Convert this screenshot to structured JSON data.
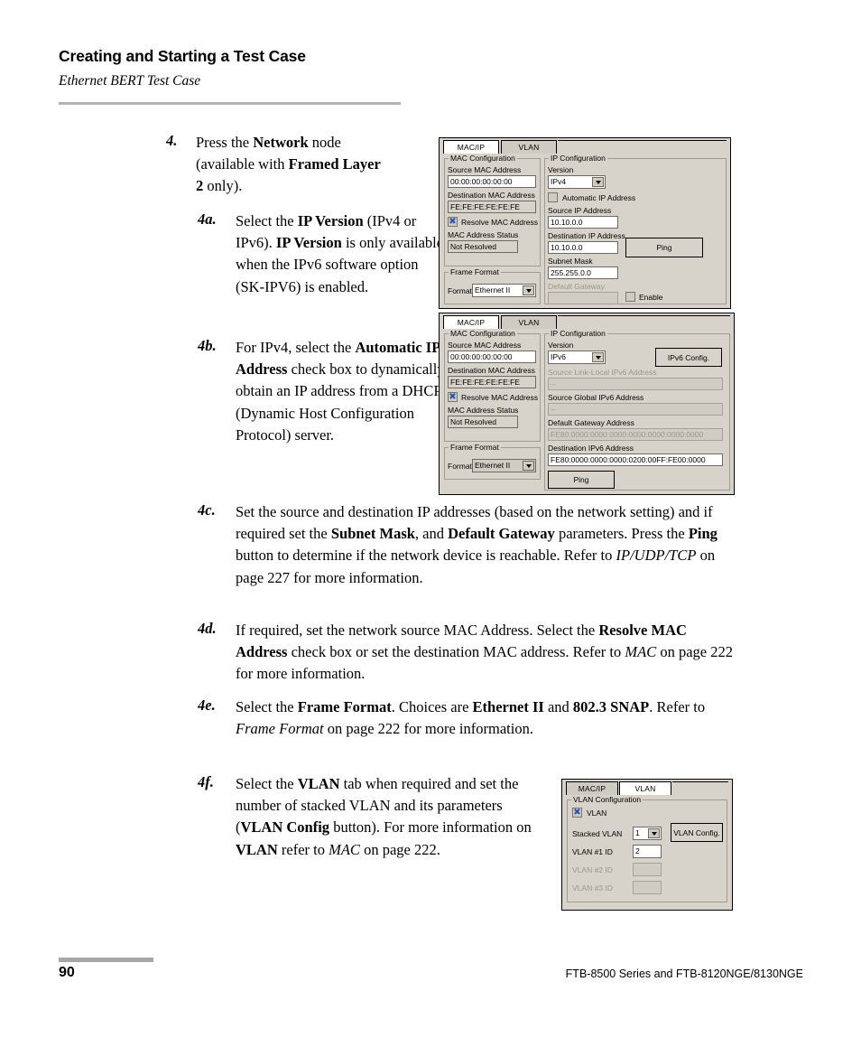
{
  "header": {
    "title": "Creating and Starting a Test Case",
    "subtitle": "Ethernet BERT Test Case"
  },
  "footer": {
    "page_number": "90",
    "product_line": "FTB-8500 Series and FTB-8120NGE/8130NGE"
  },
  "steps": [
    {
      "id": "4",
      "number": "4.",
      "text_runs": [
        {
          "t": "Press the ",
          "s": "normal"
        },
        {
          "t": "Network",
          "s": "bold"
        },
        {
          "t": " node (available with ",
          "s": "normal"
        },
        {
          "t": "Framed Layer 2",
          "s": "bold"
        },
        {
          "t": " only).",
          "s": "normal"
        }
      ]
    },
    {
      "id": "4a",
      "number": "4a.",
      "text_runs": [
        {
          "t": "Select the ",
          "s": "normal"
        },
        {
          "t": "IP Version",
          "s": "bold"
        },
        {
          "t": " (IPv4 or IPv6). ",
          "s": "normal"
        },
        {
          "t": "IP Version",
          "s": "bold"
        },
        {
          "t": " is only available when the IPv6 software option (SK-IPV6) is enabled.",
          "s": "normal"
        }
      ]
    },
    {
      "id": "4b",
      "number": "4b.",
      "text_runs": [
        {
          "t": "For IPv4, select the ",
          "s": "normal"
        },
        {
          "t": "Automatic IP Address",
          "s": "bold"
        },
        {
          "t": " check box to dynamically obtain an IP address from a DHCP (Dynamic Host Configuration Protocol) server.",
          "s": "normal"
        }
      ]
    },
    {
      "id": "4c",
      "number": "4c.",
      "text_runs": [
        {
          "t": "Set the source and destination IP addresses (based on the network setting) and if required set the ",
          "s": "normal"
        },
        {
          "t": "Subnet Mask",
          "s": "bold"
        },
        {
          "t": ", and ",
          "s": "normal"
        },
        {
          "t": "Default Gateway",
          "s": "bold"
        },
        {
          "t": " parameters. Press the ",
          "s": "normal"
        },
        {
          "t": "Ping",
          "s": "bold"
        },
        {
          "t": " button to determine if the network device is reachable. Refer to ",
          "s": "normal"
        },
        {
          "t": "IP/UDP/TCP",
          "s": "italic"
        },
        {
          "t": " on page 227 for more information.",
          "s": "normal"
        }
      ]
    },
    {
      "id": "4d",
      "number": "4d.",
      "text_runs": [
        {
          "t": "If required, set the network source MAC Address. Select the ",
          "s": "normal"
        },
        {
          "t": "Resolve MAC Address",
          "s": "bold"
        },
        {
          "t": " check box or set the destination MAC address. Refer to ",
          "s": "normal"
        },
        {
          "t": "MAC",
          "s": "italic"
        },
        {
          "t": " on page 222 for more information.",
          "s": "normal"
        }
      ]
    },
    {
      "id": "4e",
      "number": "4e.",
      "text_runs": [
        {
          "t": "Select the ",
          "s": "normal"
        },
        {
          "t": "Frame Format",
          "s": "bold"
        },
        {
          "t": ". Choices are ",
          "s": "normal"
        },
        {
          "t": "Ethernet II",
          "s": "bold"
        },
        {
          "t": " and ",
          "s": "normal"
        },
        {
          "t": "802.3 SNAP",
          "s": "bold"
        },
        {
          "t": ". Refer to ",
          "s": "normal"
        },
        {
          "t": "Frame Format",
          "s": "italic"
        },
        {
          "t": " on page 222 for more information.",
          "s": "normal"
        }
      ]
    },
    {
      "id": "4f",
      "number": "4f.",
      "text_runs": [
        {
          "t": "Select the ",
          "s": "normal"
        },
        {
          "t": "VLAN",
          "s": "bold"
        },
        {
          "t": " tab when required and set the number of stacked VLAN and its parameters (",
          "s": "normal"
        },
        {
          "t": "VLAN Config",
          "s": "bold"
        },
        {
          "t": " button). For more information on ",
          "s": "normal"
        },
        {
          "t": "VLAN",
          "s": "bold"
        },
        {
          "t": " refer to ",
          "s": "normal"
        },
        {
          "t": "MAC",
          "s": "italic"
        },
        {
          "t": " on page 222.",
          "s": "normal"
        }
      ]
    }
  ],
  "dialog_ipv4": {
    "tabs": [
      {
        "label": "MAC/IP",
        "active": true
      },
      {
        "label": "VLAN",
        "active": false
      }
    ],
    "mac_group_title": "MAC Configuration",
    "source_mac_label": "Source MAC Address",
    "source_mac_value": "00:00:00:00:00:00",
    "destination_mac_label": "Destination MAC Address",
    "destination_mac_value": "FE:FE:FE:FE:FE:FE",
    "resolve_mac_label": "Resolve MAC Address",
    "resolve_mac_checked": true,
    "mac_status_label": "MAC Address Status",
    "mac_status_value": "Not Resolved",
    "frame_format_group_title": "Frame Format",
    "format_label": "Format",
    "format_value": "Ethernet II",
    "ip_group_title": "IP Configuration",
    "version_label": "Version",
    "version_value": "IPv4",
    "automatic_ip_label": "Automatic IP Address",
    "automatic_ip_checked": false,
    "source_ip_label": "Source IP Address",
    "source_ip_value": "10.10.0.0",
    "destination_ip_label": "Destination IP Address",
    "destination_ip_value": "10.10.0.0",
    "subnet_mask_label": "Subnet Mask",
    "subnet_mask_value": "255.255.0.0",
    "default_gateway_label": "Default Gateway",
    "default_gateway_value": "",
    "enable_label": "Enable",
    "enable_checked": false,
    "ping_label": "Ping"
  },
  "dialog_ipv6": {
    "tabs": [
      {
        "label": "MAC/IP",
        "active": true
      },
      {
        "label": "VLAN",
        "active": false
      }
    ],
    "mac_group_title": "MAC Configuration",
    "source_mac_label": "Source MAC Address",
    "source_mac_value": "00:00:00:00:00:00",
    "destination_mac_label": "Destination MAC Address",
    "destination_mac_value": "FE:FE:FE:FE:FE:FE",
    "resolve_mac_label": "Resolve MAC Address",
    "resolve_mac_checked": true,
    "mac_status_label": "MAC Address Status",
    "mac_status_value": "Not Resolved",
    "frame_format_group_title": "Frame Format",
    "format_label": "Format",
    "format_value": "Ethernet II",
    "ip_group_title": "IP Configuration",
    "version_label": "Version",
    "version_value": "IPv6",
    "ipv6_config_label": "IPv6 Config.",
    "source_link_local_label": "Source Link-Local IPv6 Address",
    "source_link_local_value": "--",
    "source_global_label": "Source Global IPv6 Address",
    "source_global_value": "--",
    "default_gateway_label": "Default Gateway Address",
    "default_gateway_value": "FE80:0000:0000:0000:0000:0000:0000:0000",
    "destination_ipv6_label": "Destination IPv6 Address",
    "destination_ipv6_value": "FE80:0000:0000:0000:0200:00FF:FE00:0000",
    "ping_label": "Ping"
  },
  "dialog_vlan": {
    "tabs": [
      {
        "label": "MAC/IP",
        "active": false
      },
      {
        "label": "VLAN",
        "active": true
      }
    ],
    "group_title": "VLAN Configuration",
    "vlan_label": "VLAN",
    "vlan_checked": true,
    "stacked_vlan_label": "Stacked VLAN",
    "stacked_vlan_value": "1",
    "vlan1_label": "VLAN #1 ID",
    "vlan1_value": "2",
    "vlan2_label": "VLAN #2 ID",
    "vlan2_value": "",
    "vlan3_label": "VLAN #3 ID",
    "vlan3_value": "",
    "vlan_config_label": "VLAN Config."
  }
}
